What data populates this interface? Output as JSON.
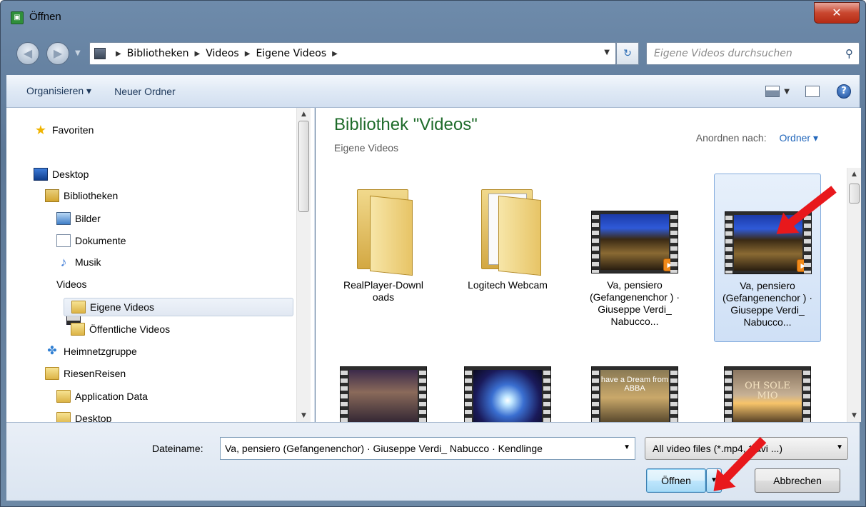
{
  "window": {
    "title": "Öffnen",
    "close_icon": "close-icon"
  },
  "nav": {
    "back_icon": "back-arrow-icon",
    "forward_icon": "forward-arrow-icon",
    "breadcrumb": [
      "Bibliotheken",
      "Videos",
      "Eigene Videos"
    ],
    "search_placeholder": "Eigene Videos durchsuchen"
  },
  "toolbar": {
    "organize": "Organisieren ▾",
    "new_folder": "Neuer Ordner"
  },
  "sidebar": {
    "items": [
      {
        "label": "Favoriten",
        "icon": "star-icon"
      },
      {
        "label": "Desktop",
        "icon": "desktop-icon"
      },
      {
        "label": "Bibliotheken",
        "icon": "library-icon"
      },
      {
        "label": "Bilder",
        "icon": "pictures-icon"
      },
      {
        "label": "Dokumente",
        "icon": "document-icon"
      },
      {
        "label": "Musik",
        "icon": "music-icon"
      },
      {
        "label": "Videos",
        "icon": "video-icon"
      },
      {
        "label": "Eigene Videos",
        "icon": "video-folder-icon"
      },
      {
        "label": "Öffentliche Videos",
        "icon": "folder-icon"
      },
      {
        "label": "Heimnetzgruppe",
        "icon": "homegroup-icon"
      },
      {
        "label": "RiesenReisen",
        "icon": "user-folder-icon"
      },
      {
        "label": "Application Data",
        "icon": "folder-icon"
      },
      {
        "label": "Desktop",
        "icon": "desktop-folder-icon"
      }
    ]
  },
  "content": {
    "title": "Bibliothek \"Videos\"",
    "subtitle": "Eigene Videos",
    "arrange_label": "Anordnen nach:",
    "arrange_value": "Ordner ▾",
    "tiles": [
      {
        "label": "RealPlayer-Downl oads"
      },
      {
        "label": "Logitech Webcam"
      },
      {
        "label": "Va, pensiero (Gefangenenchor ) · Giuseppe Verdi_ Nabucco..."
      },
      {
        "label": "Va, pensiero (Gefangenenchor ) · Giuseppe Verdi_ Nabucco..."
      }
    ],
    "thumb_texts": [
      "have a Dream from ABBA",
      "OH SOLE MIO"
    ]
  },
  "bottom": {
    "filename_label": "Dateiname:",
    "filename_value": "Va, pensiero (Gefangenenchor) · Giuseppe Verdi_ Nabucco · Kendlinge",
    "filter_value": "All video files (*.mp4, *.avi ...)",
    "open_label": "Öffnen",
    "cancel_label": "Abbrechen"
  },
  "colors": {
    "title_green": "#1e6b2a",
    "link_blue": "#2267bb",
    "arrow_red": "#e8181c"
  }
}
